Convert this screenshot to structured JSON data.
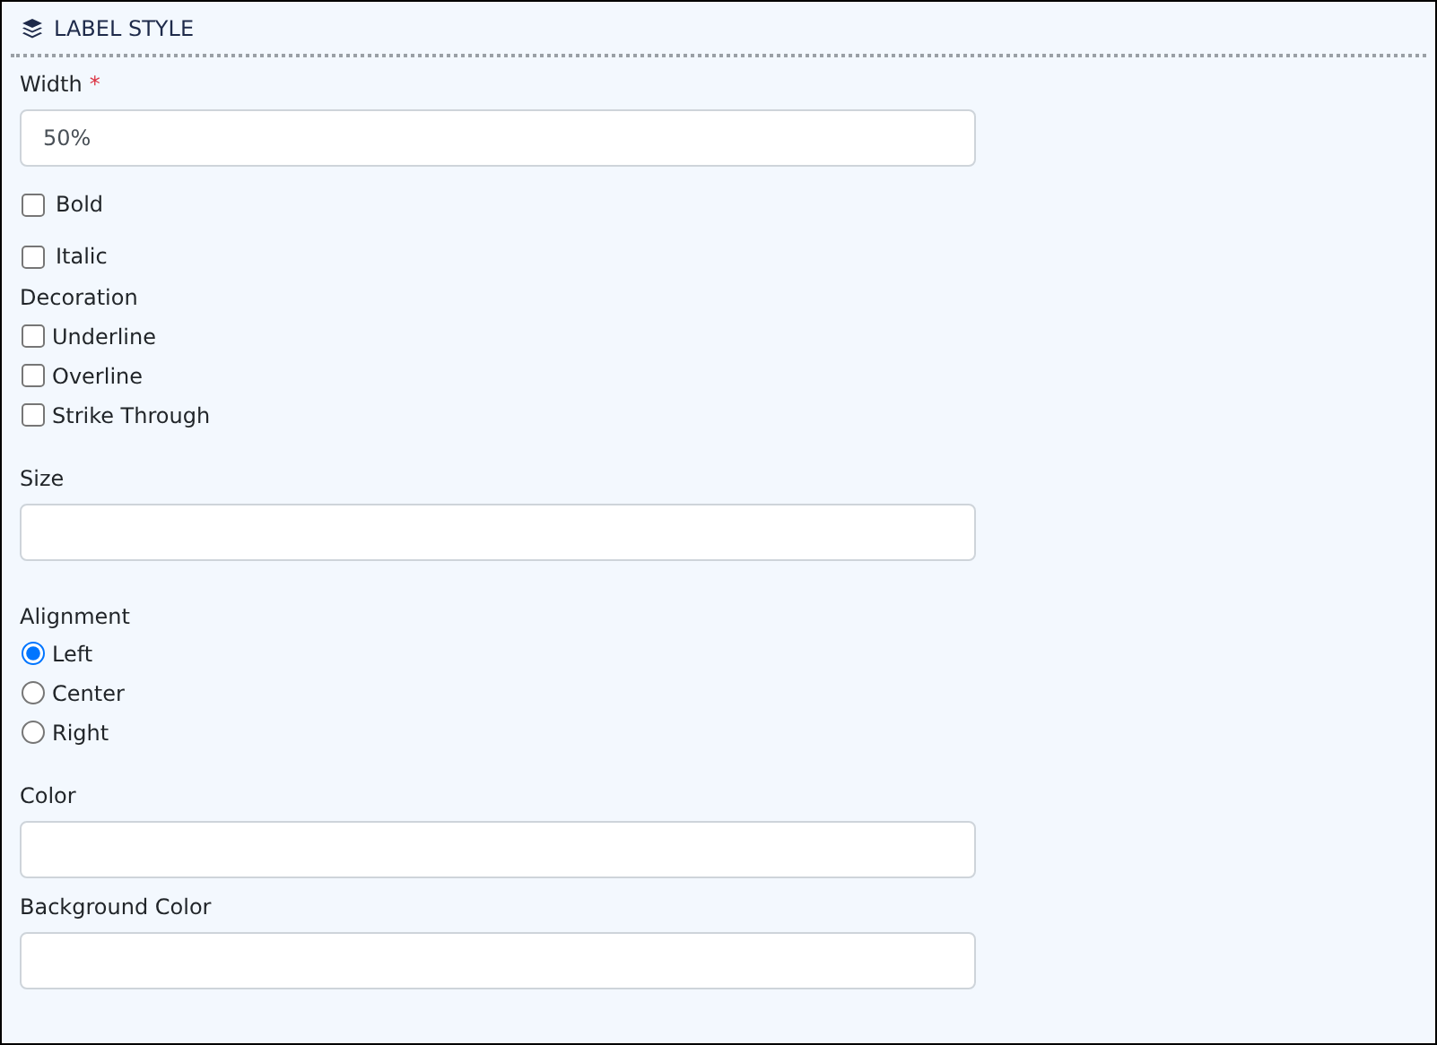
{
  "section": {
    "title": "LABEL STYLE"
  },
  "width": {
    "label": "Width",
    "required": true,
    "required_mark": "*",
    "value": "50%"
  },
  "toggles": [
    {
      "label": "Bold",
      "checked": false
    },
    {
      "label": "Italic",
      "checked": false
    }
  ],
  "decoration": {
    "label": "Decoration",
    "options": [
      {
        "label": "Underline",
        "checked": false
      },
      {
        "label": "Overline",
        "checked": false
      },
      {
        "label": "Strike Through",
        "checked": false
      }
    ]
  },
  "size": {
    "label": "Size"
  },
  "alignment": {
    "label": "Alignment",
    "options": [
      {
        "label": "Left",
        "selected": true
      },
      {
        "label": "Center",
        "selected": false
      },
      {
        "label": "Right",
        "selected": false
      }
    ]
  },
  "color": {
    "label": "Color"
  },
  "background_color": {
    "label": "Background Color"
  }
}
